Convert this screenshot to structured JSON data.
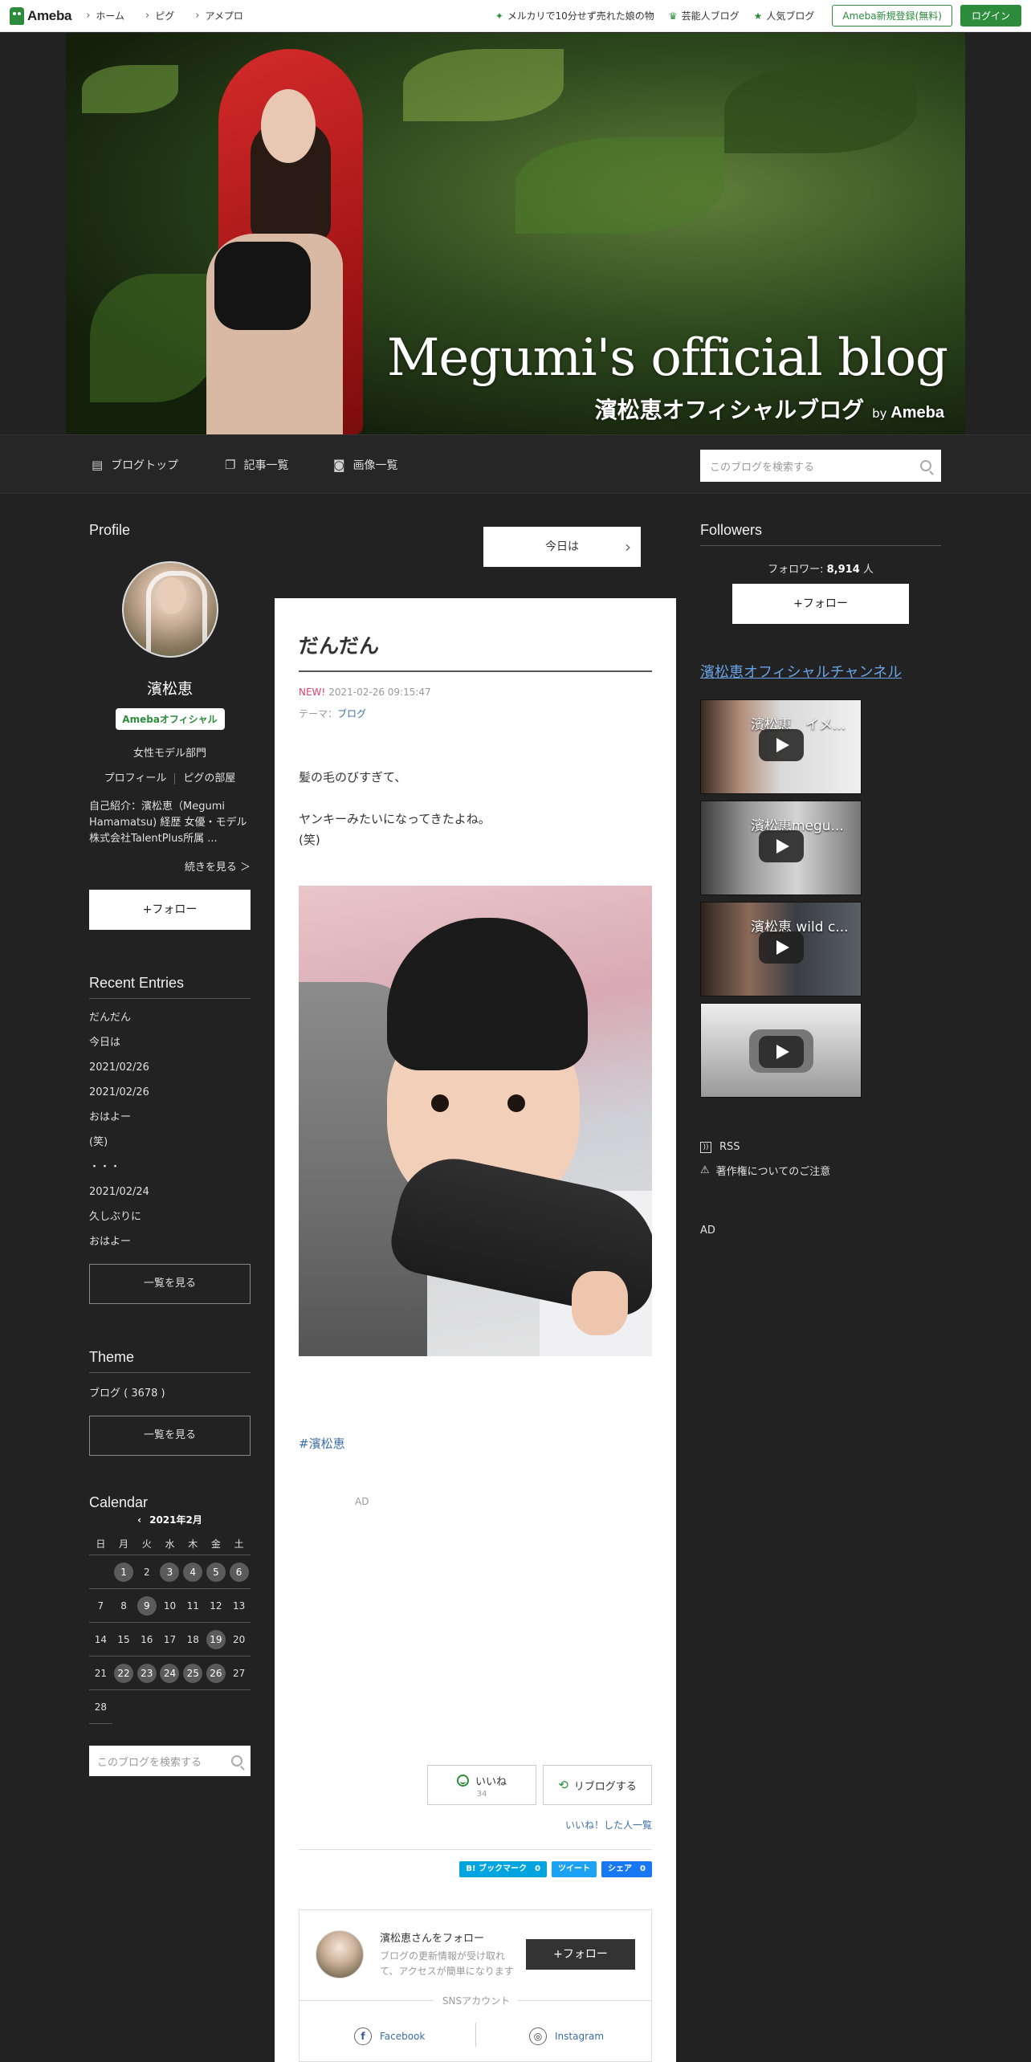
{
  "topbar": {
    "logo": "Ameba",
    "nav": [
      "ホーム",
      "ピグ",
      "アメプロ"
    ],
    "links": [
      {
        "icon": "sparkle-icon",
        "label": "メルカリで10分せず売れた娘の物"
      },
      {
        "icon": "crown-icon",
        "label": "芸能人ブログ"
      },
      {
        "icon": "star-icon",
        "label": "人気ブログ"
      }
    ],
    "register": "Ameba新規登録(無料)",
    "login": "ログイン",
    "accent": "#2d8c3c"
  },
  "header": {
    "title_en": "Megumi's official blog",
    "title_jp": "濱松恵オフィシャルブログ",
    "by": "by",
    "by_brand": "Ameba"
  },
  "navbar": {
    "items": [
      "ブログトップ",
      "記事一覧",
      "画像一覧"
    ],
    "search_placeholder": "このブログを検索する"
  },
  "profile": {
    "title": "Profile",
    "name": "濱松恵",
    "badge": "Amebaオフィシャル",
    "category": "女性モデル部門",
    "link_profile": "プロフィール",
    "link_pig": "ピグの部屋",
    "intro": "自己紹介：濱松恵（Megumi Hamamatsu) 経歴 女優・モデル 株式会社TalentPlus所属 ...",
    "more": "続きを見る ＞",
    "follow": "+フォロー"
  },
  "recent": {
    "title": "Recent Entries",
    "items": [
      "だんだん",
      "今日は",
      "2021/02/26",
      "2021/02/26",
      "おはよー",
      "(笑)",
      "・・・",
      "2021/02/24",
      "久しぶりに",
      "おはよー"
    ],
    "more": "一覧を見る"
  },
  "theme": {
    "title": "Theme",
    "item": "ブログ ( 3678 )",
    "more": "一覧を見る"
  },
  "calendar": {
    "title": "Calendar",
    "arrow": "‹",
    "month": "2021年2月",
    "dow": [
      "日",
      "月",
      "火",
      "水",
      "木",
      "金",
      "土"
    ],
    "days": [
      {
        "d": "",
        "m": false
      },
      {
        "d": "1",
        "m": true
      },
      {
        "d": "2",
        "m": false
      },
      {
        "d": "3",
        "m": true
      },
      {
        "d": "4",
        "m": true
      },
      {
        "d": "5",
        "m": true
      },
      {
        "d": "6",
        "m": true
      },
      {
        "d": "7",
        "m": false
      },
      {
        "d": "8",
        "m": false
      },
      {
        "d": "9",
        "m": true
      },
      {
        "d": "10",
        "m": false
      },
      {
        "d": "11",
        "m": false
      },
      {
        "d": "12",
        "m": false
      },
      {
        "d": "13",
        "m": false
      },
      {
        "d": "14",
        "m": false
      },
      {
        "d": "15",
        "m": false
      },
      {
        "d": "16",
        "m": false
      },
      {
        "d": "17",
        "m": false
      },
      {
        "d": "18",
        "m": false
      },
      {
        "d": "19",
        "m": true
      },
      {
        "d": "20",
        "m": false
      },
      {
        "d": "21",
        "m": false
      },
      {
        "d": "22",
        "m": true
      },
      {
        "d": "23",
        "m": true
      },
      {
        "d": "24",
        "m": true
      },
      {
        "d": "25",
        "m": true
      },
      {
        "d": "26",
        "m": true
      },
      {
        "d": "27",
        "m": false
      },
      {
        "d": "28",
        "m": false
      }
    ]
  },
  "side_search": {
    "placeholder": "このブログを検索する"
  },
  "article": {
    "today_btn": "今日は",
    "title": "だんだん",
    "new": "NEW!",
    "date": "2021-02-26 09:15:47",
    "theme_label": "テーマ：",
    "theme_link": "ブログ",
    "body": [
      "髪の毛のびすぎて、",
      "",
      "ヤンキーみたいになってきたよね。",
      "(笑)"
    ],
    "hashtag": "#濱松恵",
    "ad": "AD",
    "like": "いいね",
    "like_count": "34",
    "reblog": "リブログする",
    "liked_list": "いいね！した人一覧",
    "share": {
      "hatena": "B! ブックマーク　0",
      "tweet": "ツイート",
      "fb": "シェア　0"
    },
    "follow_card": {
      "name": "濱松恵さんをフォロー",
      "desc": "ブログの更新情報が受け取れて、アクセスが簡単になります",
      "btn": "+フォロー",
      "sns_label": "SNSアカウント",
      "facebook": "Facebook",
      "instagram": "Instagram"
    }
  },
  "followers": {
    "title": "Followers",
    "label": "フォロワー: ",
    "count": "8,914",
    "unit": " 人",
    "follow": "+フォロー"
  },
  "channel": {
    "title": "濱松恵オフィシャルチャンネル",
    "videos": [
      "濱松恵　イメ...",
      "濱松恵megu...",
      "濱松恵 wild c...",
      ""
    ]
  },
  "footer_links": {
    "rss": "RSS",
    "copyright": "著作権についてのご注意",
    "ad": "AD"
  }
}
